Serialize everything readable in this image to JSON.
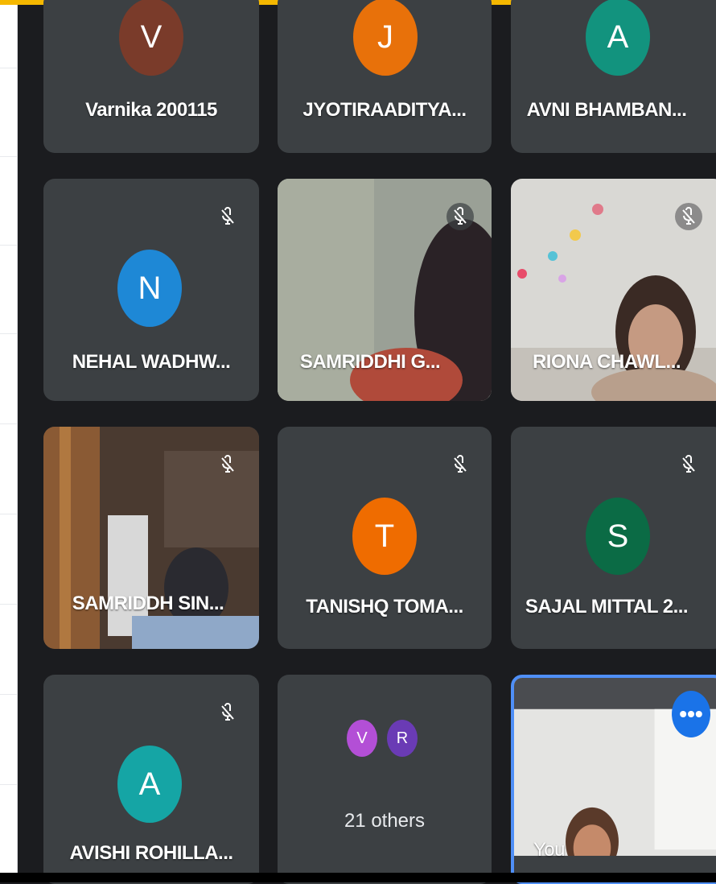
{
  "colors": {
    "top_bar": "#f5b800",
    "tile_bg": "#3c4043",
    "self_border": "#4f8ff7",
    "more_button": "#1a73e8"
  },
  "participants": [
    {
      "initial": "V",
      "name": "Varnika 200115",
      "avatar_color": "#7a3b2a",
      "muted": false
    },
    {
      "initial": "J",
      "name": "JYOTIRAADITYA...",
      "avatar_color": "#e8710a",
      "muted": false
    },
    {
      "initial": "A",
      "name": "AVNI BHAMBAN...",
      "avatar_color": "#12937e",
      "muted": false
    },
    {
      "initial": "N",
      "name": "NEHAL WADHW...",
      "avatar_color": "#1e88d6",
      "muted": true
    },
    {
      "name": "SAMRIDDHI G...",
      "video": true,
      "muted": true
    },
    {
      "name": "RIONA CHAWL...",
      "video": true,
      "muted": true
    },
    {
      "name": "SAMRIDDH SIN...",
      "video": true,
      "muted": true
    },
    {
      "initial": "T",
      "name": "TANISHQ TOMA...",
      "avatar_color": "#ef6c00",
      "muted": true
    },
    {
      "initial": "S",
      "name": "SAJAL MITTAL 2...",
      "avatar_color": "#0b6b45",
      "muted": true
    },
    {
      "initial": "A",
      "name": "AVISHI ROHILLA...",
      "avatar_color": "#15a5a5",
      "muted": true
    }
  ],
  "others_tile": {
    "avatars": [
      {
        "initial": "V",
        "color": "#b34fd6"
      },
      {
        "initial": "R",
        "color": "#6a3bb5"
      }
    ],
    "label": "21 others"
  },
  "self_tile": {
    "label": "You",
    "more_icon": "more-horiz-icon",
    "more_label": "•••"
  },
  "icons": {
    "mic_off": "mic-off-icon"
  }
}
